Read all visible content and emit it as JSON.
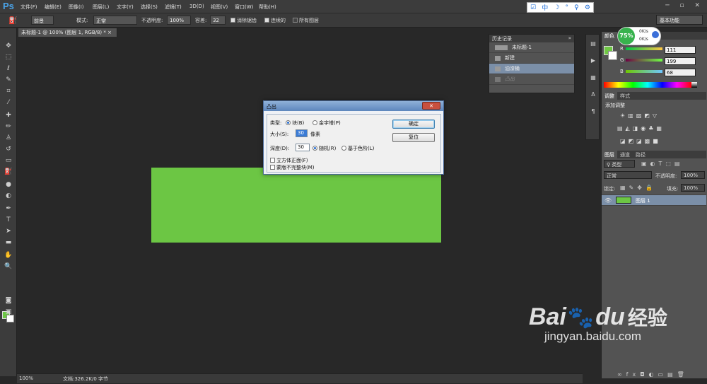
{
  "app": {
    "logo": "Ps",
    "menus": [
      "文件(F)",
      "编辑(E)",
      "图像(I)",
      "图层(L)",
      "文字(Y)",
      "选择(S)",
      "滤镜(T)",
      "3D(D)",
      "视图(V)",
      "窗口(W)",
      "帮助(H)"
    ],
    "workspace": "基本功能"
  },
  "ime": {
    "icons": [
      "中",
      "☽",
      "°",
      "♀",
      "⚙"
    ]
  },
  "options": {
    "fill_source": "前景",
    "mode_label": "模式:",
    "mode_value": "正常",
    "opacity_label": "不透明度:",
    "opacity_value": "100%",
    "tolerance_label": "容差:",
    "tolerance_value": "32",
    "antialias": "消除锯齿",
    "contiguous": "连续的",
    "all_layers": "所有图层"
  },
  "document": {
    "tab_title": "未标题-1 @ 100% (图层 1, RGB/8) *",
    "zoom": "100%",
    "status": "文档:326.2K/0 字节"
  },
  "history": {
    "title": "历史记录",
    "snapshot": "未标题-1",
    "items": [
      {
        "label": "新建",
        "state": "normal"
      },
      {
        "label": "油漆桶",
        "state": "selected"
      },
      {
        "label": "凸出",
        "state": "dim"
      }
    ]
  },
  "color_panel": {
    "tabs": [
      "颜色"
    ],
    "r_label": "R",
    "g_label": "G",
    "b_label": "B",
    "r": "111",
    "g": "199",
    "b": "68",
    "fg": "#6fc744"
  },
  "adjustments": {
    "tabs": [
      "调整",
      "样式"
    ],
    "title": "添加调整"
  },
  "layers": {
    "tabs": [
      "图层",
      "通道",
      "路径"
    ],
    "kind": "类型",
    "blend": "正常",
    "opacity_label": "不透明度:",
    "opacity": "100%",
    "lock_label": "锁定:",
    "fill_label": "填充:",
    "fill": "100%",
    "layer_name": "图层 1"
  },
  "battery": {
    "percent": "75%",
    "up": "0K/s",
    "down": "0K/s"
  },
  "dialog": {
    "title": "凸出",
    "type_label": "类型:",
    "type_block": "块(B)",
    "type_pyramid": "金字塔(P)",
    "size_label": "大小(S):",
    "size_value": "30",
    "size_unit": "像素",
    "depth_label": "深度(D):",
    "depth_value": "30",
    "depth_random": "随机(R)",
    "depth_level": "基于色阶(L)",
    "solid_front": "立方体正面(F)",
    "mask_incomplete": "蒙版不完整块(M)",
    "ok": "确定",
    "reset": "复位",
    "close": "✕"
  },
  "watermark": {
    "brand": "Bai",
    "brand2": "du",
    "brand3": "经验",
    "url": "jingyan.baidu.com"
  }
}
